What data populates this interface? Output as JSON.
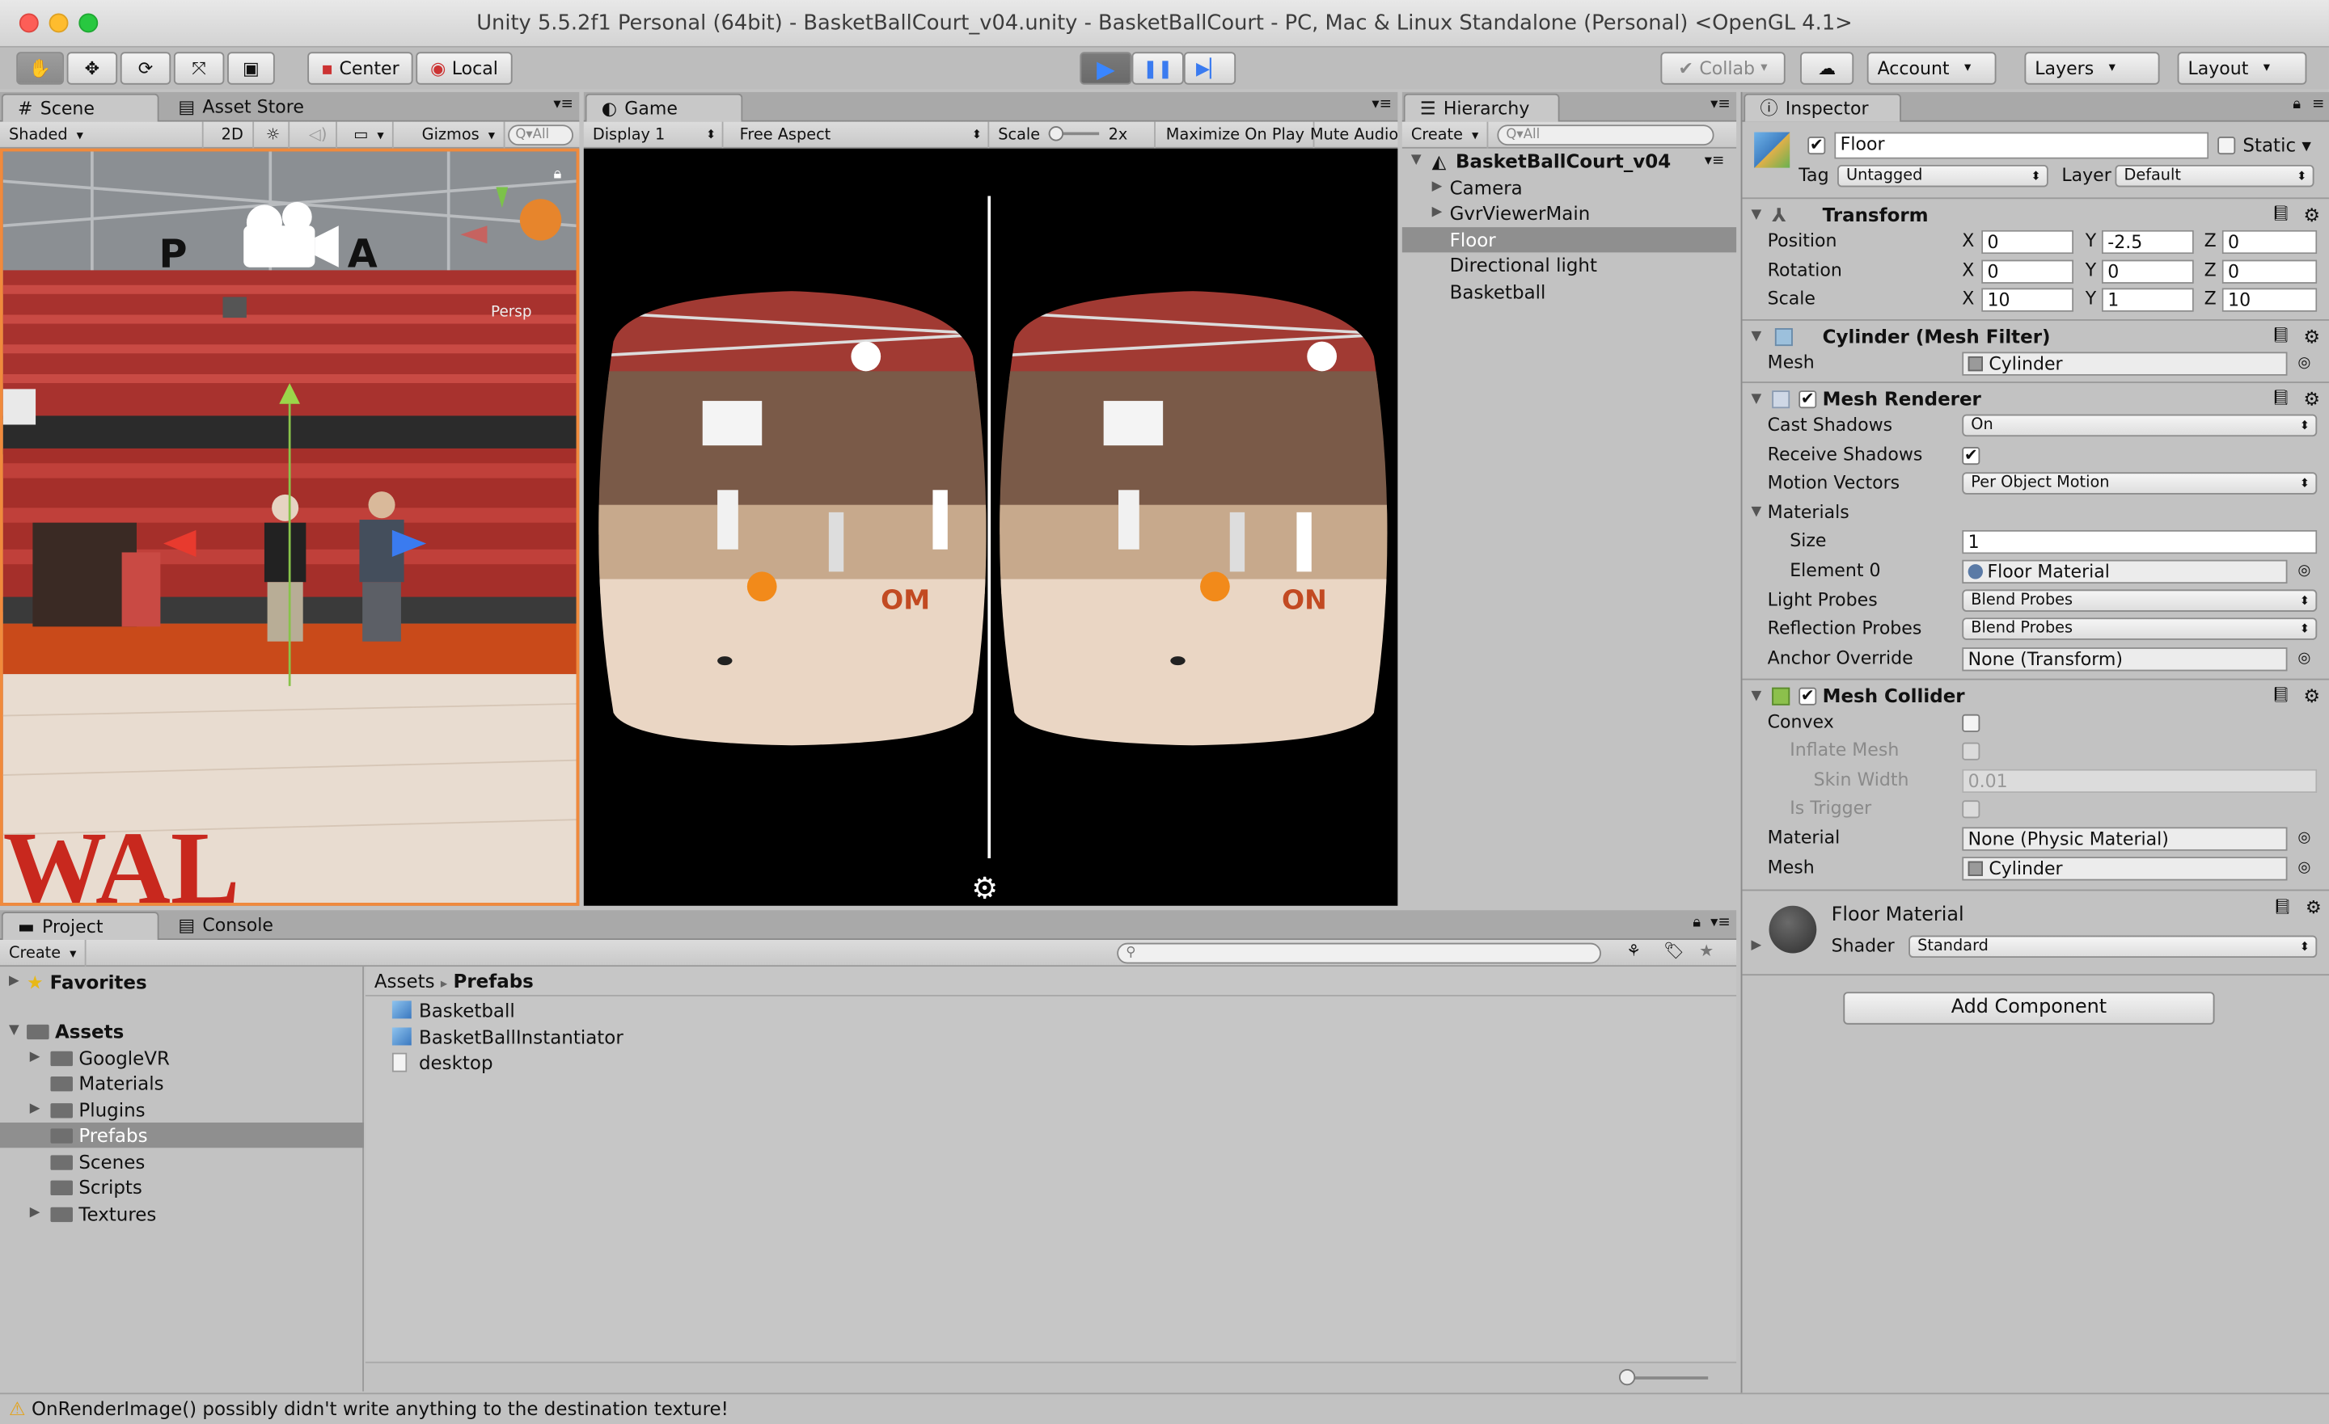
{
  "window": {
    "title": "Unity 5.5.2f1 Personal (64bit) - BasketBallCourt_v04.unity - BasketBallCourt - PC, Mac & Linux Standalone (Personal) <OpenGL 4.1>"
  },
  "toolbar": {
    "pivot": "Center",
    "space": "Local",
    "collab": "Collab",
    "account": "Account",
    "layers": "Layers",
    "layout": "Layout"
  },
  "scene": {
    "tab_scene": "Scene",
    "tab_store": "Asset Store",
    "shading": "Shaded",
    "mode2d": "2D",
    "gizmos": "Gizmos",
    "search": "Q▾All",
    "persp": "Persp"
  },
  "game": {
    "tab": "Game",
    "display": "Display 1",
    "aspect": "Free Aspect",
    "scale_label": "Scale",
    "scale_value": "2x",
    "maximize": "Maximize On Play",
    "mute": "Mute Audio"
  },
  "hierarchy": {
    "tab": "Hierarchy",
    "create": "Create",
    "search": "Q▾All",
    "scene_name": "BasketBallCourt_v04",
    "items": [
      "Camera",
      "GvrViewerMain",
      "Floor",
      "Directional light",
      "Basketball"
    ]
  },
  "inspector": {
    "tab": "Inspector",
    "object_name": "Floor",
    "static": "Static",
    "tag_label": "Tag",
    "tag": "Untagged",
    "layer_label": "Layer",
    "layer": "Default",
    "transform": {
      "title": "Transform",
      "position": "Position",
      "rotation": "Rotation",
      "scale": "Scale",
      "x": "X",
      "y": "Y",
      "z": "Z",
      "pos": [
        "0",
        "-2.5",
        "0"
      ],
      "rot": [
        "0",
        "0",
        "0"
      ],
      "scl": [
        "10",
        "1",
        "10"
      ]
    },
    "mesh_filter": {
      "title": "Cylinder (Mesh Filter)",
      "mesh_label": "Mesh",
      "mesh": "Cylinder"
    },
    "mesh_renderer": {
      "title": "Mesh Renderer",
      "cast_shadows": "Cast Shadows",
      "cast_val": "On",
      "receive_shadows": "Receive Shadows",
      "motion_vectors": "Motion Vectors",
      "motion_val": "Per Object Motion",
      "materials": "Materials",
      "size": "Size",
      "size_val": "1",
      "element0": "Element 0",
      "element0_val": "Floor Material",
      "light_probes": "Light Probes",
      "light_val": "Blend Probes",
      "reflection_probes": "Reflection Probes",
      "reflection_val": "Blend Probes",
      "anchor": "Anchor Override",
      "anchor_val": "None (Transform)"
    },
    "mesh_collider": {
      "title": "Mesh Collider",
      "convex": "Convex",
      "inflate": "Inflate Mesh",
      "skin": "Skin Width",
      "skin_val": "0.01",
      "trigger": "Is Trigger",
      "material": "Material",
      "material_val": "None (Physic Material)",
      "mesh": "Mesh",
      "mesh_val": "Cylinder"
    },
    "material": {
      "name": "Floor Material",
      "shader_label": "Shader",
      "shader": "Standard"
    },
    "add_component": "Add Component"
  },
  "project": {
    "tab_project": "Project",
    "tab_console": "Console",
    "create": "Create",
    "favorites": "Favorites",
    "assets": "Assets",
    "folders": [
      "GoogleVR",
      "Materials",
      "Plugins",
      "Prefabs",
      "Scenes",
      "Scripts",
      "Textures"
    ],
    "breadcrumb_root": "Assets",
    "breadcrumb_sep": "▸",
    "breadcrumb_current": "Prefabs",
    "files": [
      "Basketball",
      "BasketBallInstantiator",
      "desktop"
    ]
  },
  "status": {
    "message": "OnRenderImage() possibly didn't write anything to the destination texture!"
  },
  "colors": {
    "accent_play": "#3478f6",
    "selection": "#8f8f8f",
    "warning": "#e3a21a"
  }
}
